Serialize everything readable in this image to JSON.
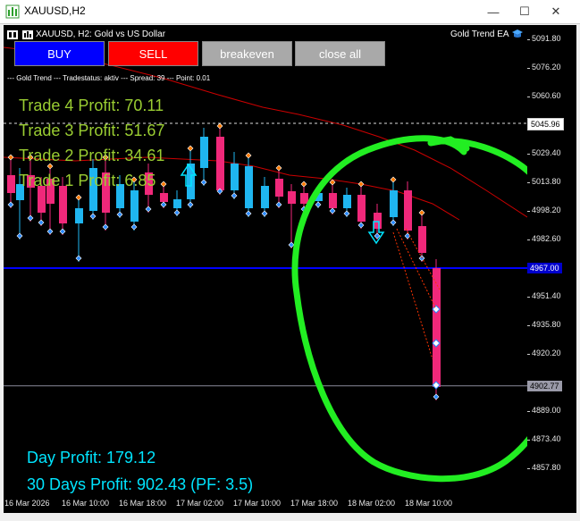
{
  "window": {
    "title": "XAUUSD,H2",
    "minimize_glyph": "—",
    "maximize_glyph": "☐",
    "close_glyph": "✕"
  },
  "chart": {
    "symbol_line": "XAUUSD, H2:  Gold vs US Dollar",
    "ea_name": "Gold Trend EA",
    "status_line": "--- Gold Trend --- Tradestatus: aktiv --- Spread: 39 --- Point: 0.01"
  },
  "buttons": {
    "buy": "BUY",
    "sell": "SELL",
    "breakeven": "breakeven",
    "close_all": "close all"
  },
  "trades": [
    "Trade 4 Profit: 70.11",
    "Trade 3 Profit: 51.67",
    "Trade 2 Profit: 34.61",
    "Trade 1 Profit: 6.85"
  ],
  "summary": {
    "day_profit": "Day Profit: 179.12",
    "month_profit": "30 Days Profit: 902.43 (PF: 3.5)"
  },
  "price_axis": [
    "5091.80",
    "5076.20",
    "5060.60",
    "5029.40",
    "5013.80",
    "4998.20",
    "4982.60",
    "4967.00",
    "4951.40",
    "4935.80",
    "4920.20",
    "4889.00",
    "4873.40",
    "4857.80"
  ],
  "price_tags": {
    "current": "5045.96",
    "level": "4967.00",
    "low": "4902.77"
  },
  "time_axis": [
    "16 Mar 2026",
    "16 Mar 10:00",
    "16 Mar 18:00",
    "17 Mar 02:00",
    "17 Mar 10:00",
    "17 Mar 18:00",
    "18 Mar 02:00",
    "18 Mar 10:00"
  ],
  "colors": {
    "buy_button": "#0000ff",
    "sell_button": "#ff0000",
    "neutral_button": "#a9a9a9",
    "bull_candle": "#1fb6f0",
    "bear_candle": "#f0287a",
    "profit_text": "#9acd32",
    "summary_text": "#00e5ff",
    "moving_average": "#cc0000",
    "level_line": "#0000ff",
    "highlight_circle": "#22ee22"
  },
  "icons": {
    "app": "chart-app-icon",
    "ea": "graduation-cap-icon",
    "symbol_toggle": "chart-toggle-icon"
  }
}
